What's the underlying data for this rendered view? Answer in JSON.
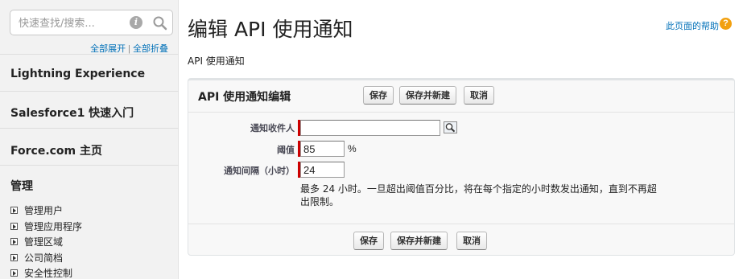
{
  "sidebar": {
    "search_placeholder": "快速查找/搜索...",
    "expand_all": "全部展开",
    "separator": "|",
    "collapse_all": "全部折叠",
    "sections": [
      {
        "title": "Lightning Experience"
      },
      {
        "title": "Salesforce1 快速入门"
      },
      {
        "title": "Force.com 主页"
      },
      {
        "title": "管理"
      }
    ],
    "admin_items": [
      "管理用户",
      "管理应用程序",
      "管理区域",
      "公司简档",
      "安全性控制"
    ]
  },
  "header": {
    "title": "编辑 API 使用通知",
    "help_link": "此页面的帮助",
    "breadcrumb": "API 使用通知"
  },
  "form": {
    "title": "API 使用通知编辑",
    "buttons": {
      "save": "保存",
      "save_new": "保存并新建",
      "cancel": "取消"
    },
    "fields": {
      "recipient": {
        "label": "通知收件人",
        "value": ""
      },
      "threshold": {
        "label": "阈值",
        "value": "85",
        "unit": "%"
      },
      "interval": {
        "label": "通知间隔（小时）",
        "value": "24"
      }
    },
    "help_text": "最多 24 小时。一旦超出阈值百分比，将在每个指定的小时数发出通知，直到不再超出限制。"
  },
  "colors": {
    "required_bar": "#cc0000",
    "link": "#0070b8",
    "help_badge": "#f2a00f"
  }
}
